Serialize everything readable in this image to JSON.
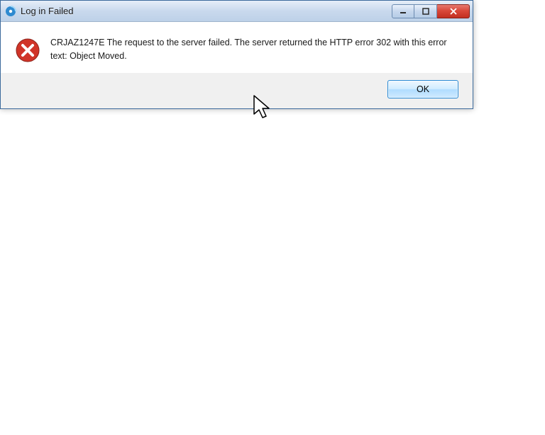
{
  "dialog": {
    "title": "Log in Failed",
    "message": "CRJAZ1247E The request to the server failed.  The server returned the HTTP error 302 with this error text: Object Moved.",
    "ok_label": "OK"
  },
  "icons": {
    "app": "app-icon",
    "error": "error-icon",
    "minimize": "—",
    "maximize": "☐",
    "close": "✕"
  }
}
